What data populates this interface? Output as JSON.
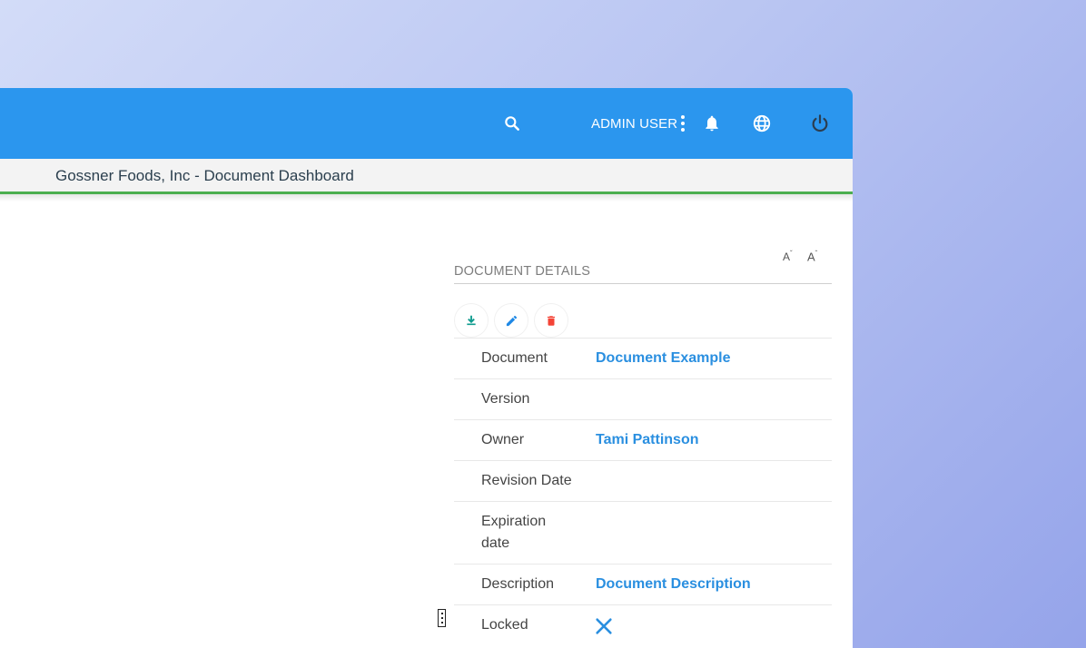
{
  "header": {
    "user_label": "ADMIN USER",
    "icons": [
      "search-icon",
      "kebab-icon",
      "bell-icon",
      "globe-icon",
      "power-icon"
    ]
  },
  "subheader": {
    "title": "Gossner Foods, Inc - Document Dashboard"
  },
  "font_controls": {
    "decrease": "A",
    "increase": "A"
  },
  "panel": {
    "title": "DOCUMENT DETAILS",
    "actions": [
      "download-icon",
      "edit-icon",
      "delete-icon"
    ],
    "rows": [
      {
        "label": "Document",
        "value": "Document Example"
      },
      {
        "label": "Version",
        "value": ""
      },
      {
        "label": "Owner",
        "value": "Tami Pattinson"
      },
      {
        "label": "Revision Date",
        "value": ""
      },
      {
        "label": "Expiration date",
        "value": ""
      },
      {
        "label": "Description",
        "value": "Document Description"
      },
      {
        "label": "Locked",
        "value": ""
      }
    ]
  },
  "colors": {
    "header": "#2b96ee",
    "accent_line": "#4caf50",
    "link": "#2a8fe0",
    "download": "#0f9b8e",
    "edit": "#1e88e5",
    "delete": "#f44336"
  }
}
